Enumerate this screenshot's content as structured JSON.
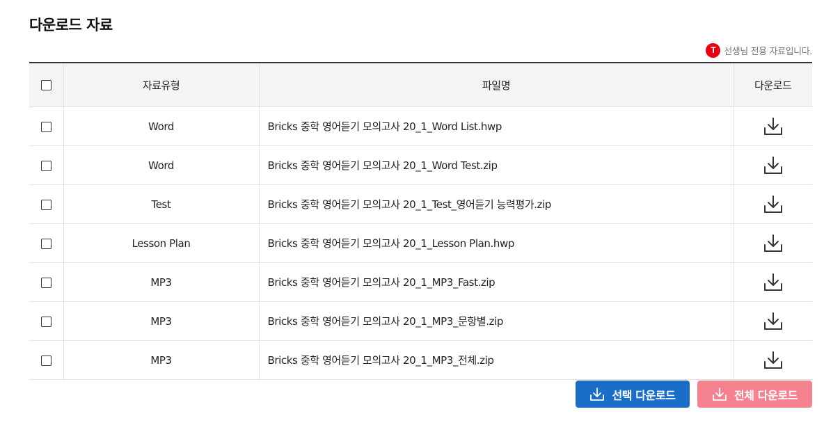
{
  "page": {
    "title": "다운로드 자료",
    "note_badge": "T",
    "note_text": "선생님 전용 자료입니다."
  },
  "table": {
    "headers": {
      "type": "자료유형",
      "filename": "파일명",
      "download": "다운로드"
    },
    "rows": [
      {
        "type": "Word",
        "filename": "Bricks 중학 영어듣기 모의고사 20_1_Word List.hwp"
      },
      {
        "type": "Word",
        "filename": "Bricks 중학 영어듣기 모의고사 20_1_Word Test.zip"
      },
      {
        "type": "Test",
        "filename": "Bricks 중학 영어듣기 모의고사 20_1_Test_영어듣기 능력평가.zip"
      },
      {
        "type": "Lesson Plan",
        "filename": "Bricks 중학 영어듣기 모의고사 20_1_Lesson Plan.hwp"
      },
      {
        "type": "MP3",
        "filename": "Bricks 중학 영어듣기 모의고사 20_1_MP3_Fast.zip"
      },
      {
        "type": "MP3",
        "filename": "Bricks 중학 영어듣기 모의고사 20_1_MP3_문항별.zip"
      },
      {
        "type": "MP3",
        "filename": "Bricks 중학 영어듣기 모의고사 20_1_MP3_전체.zip"
      }
    ]
  },
  "buttons": {
    "select_download": "선택 다운로드",
    "all_download": "전체 다운로드"
  },
  "icons": {
    "download": "download-icon",
    "checkbox": "checkbox-icon"
  },
  "colors": {
    "select_button": "#1a6ec8",
    "all_button": "#f4838f",
    "badge": "#e60012"
  }
}
